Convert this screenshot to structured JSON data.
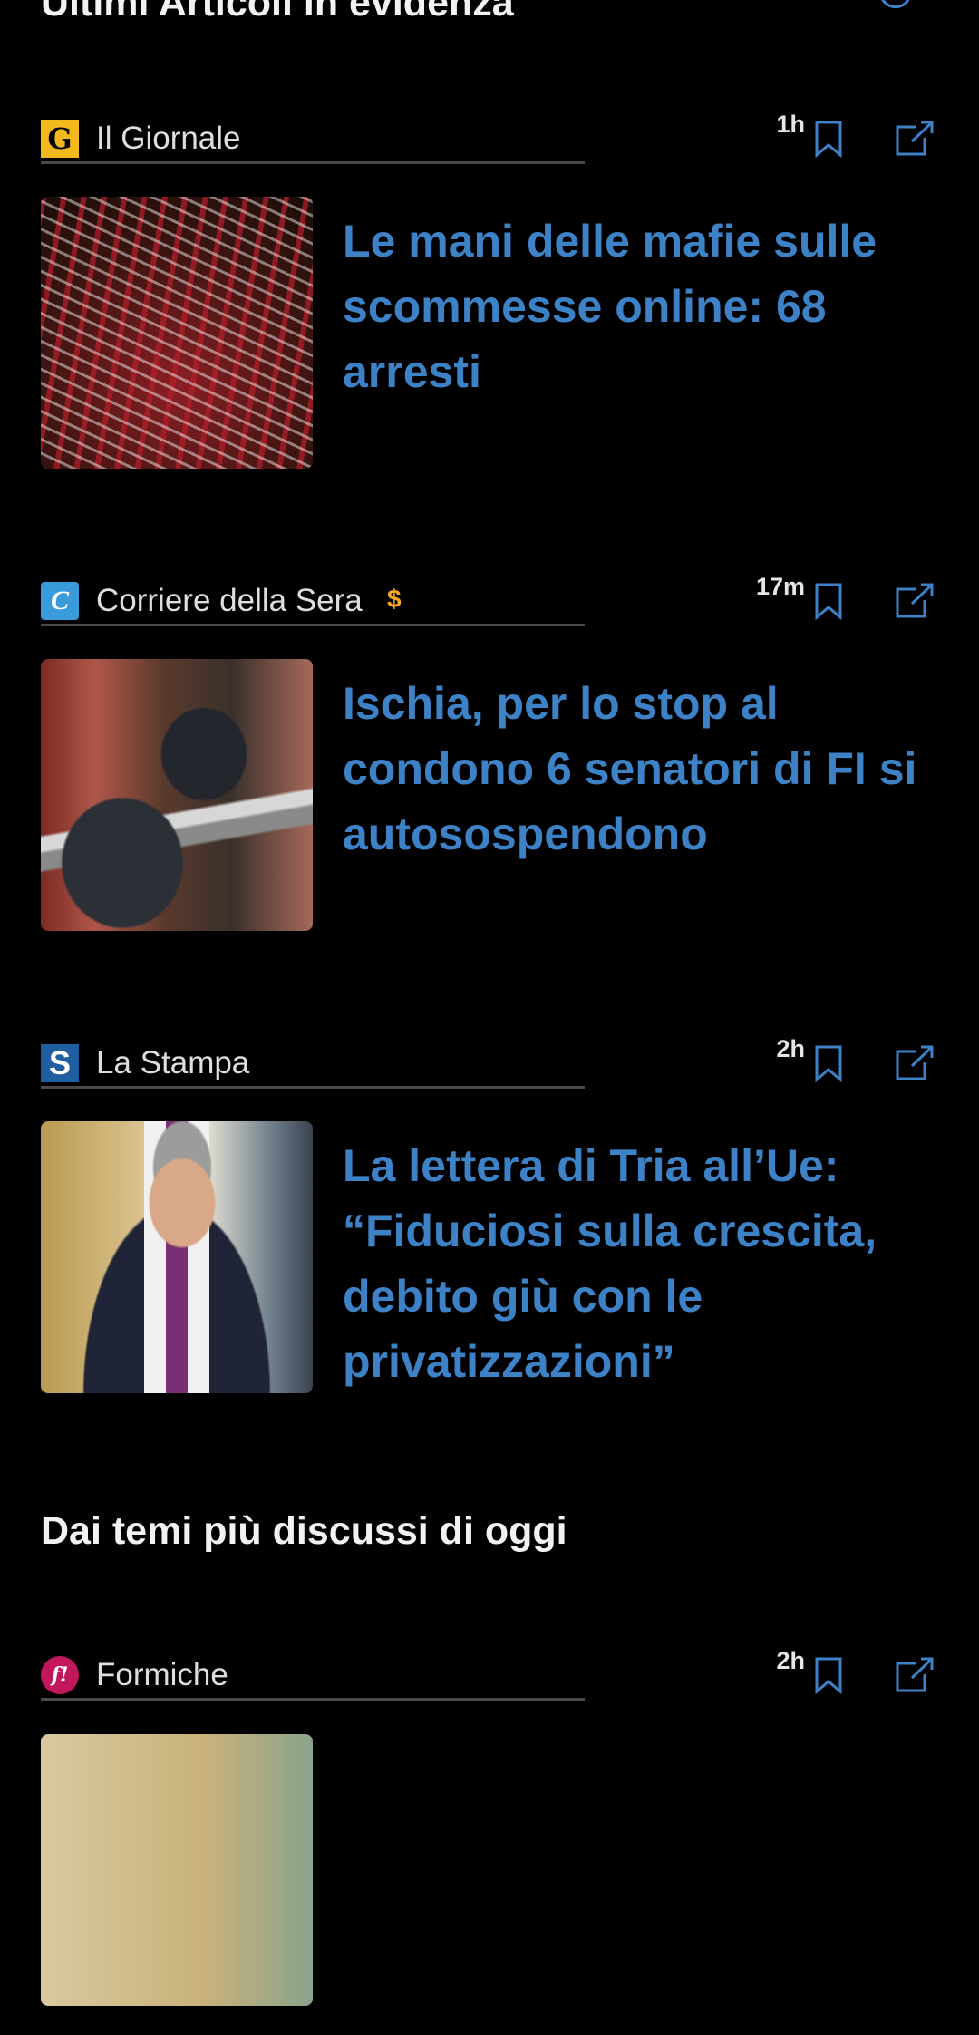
{
  "sections": {
    "top_title": "Ultimi Articoli in evidenza",
    "themes_title": "Dai temi più discussi di oggi"
  },
  "colors": {
    "accent": "#3d82c6",
    "paywall": "#f5a623",
    "background": "#000000"
  },
  "articles": [
    {
      "source": "Il Giornale",
      "logo_text": "G",
      "time": "1h",
      "headline": "Le mani delle mafie sulle scommesse online: 68 arresti",
      "paywall": ""
    },
    {
      "source": "Corriere della Sera",
      "logo_text": "C",
      "time": "17m",
      "headline": "Ischia, per lo stop al condono 6 senatori di FI si autosospendono",
      "paywall": "$"
    },
    {
      "source": "La Stampa",
      "logo_text": "S",
      "time": "2h",
      "headline": "La lettera di Tria all’Ue: “Fiduciosi sulla crescita, debito giù con le privatizzazioni”",
      "paywall": ""
    },
    {
      "source": "Formiche",
      "logo_text": "f!",
      "time": "2h",
      "headline": "",
      "paywall": ""
    }
  ]
}
